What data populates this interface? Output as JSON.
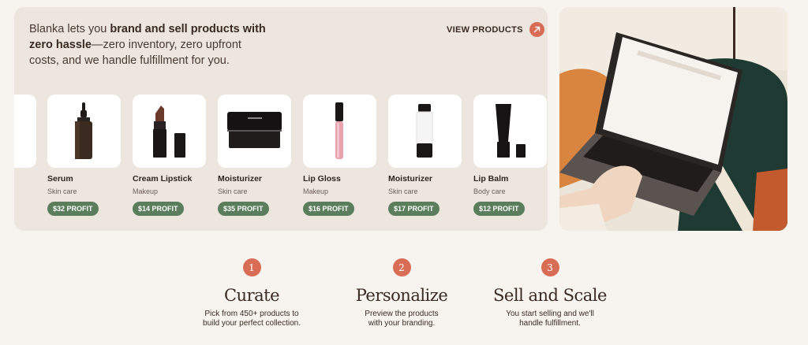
{
  "intro": {
    "prefix": "Blanka lets you ",
    "bold": "brand and sell products with zero hassle",
    "suffix": "—zero inventory, zero upfront costs, and we handle fulfillment for you."
  },
  "view_products": {
    "label": "VIEW PRODUCTS",
    "icon": "arrow-up-right-icon"
  },
  "products": [
    {
      "name": "Serum",
      "category": "Skin care",
      "profit": "$32 PROFIT"
    },
    {
      "name": "Cream Lipstick",
      "category": "Makeup",
      "profit": "$14 PROFIT"
    },
    {
      "name": "Moisturizer",
      "category": "Skin care",
      "profit": "$35 PROFIT"
    },
    {
      "name": "Lip Gloss",
      "category": "Makeup",
      "profit": "$16 PROFIT"
    },
    {
      "name": "Moisturizer",
      "category": "Skin care",
      "profit": "$17 PROFIT"
    },
    {
      "name": "Lip Balm",
      "category": "Body care",
      "profit": "$12 PROFIT"
    }
  ],
  "steps": [
    {
      "number": "1",
      "title": "Curate",
      "desc_line1": "Pick from 450+ products to",
      "desc_line2": "build your perfect collection."
    },
    {
      "number": "2",
      "title": "Personalize",
      "desc_line1": "Preview the products",
      "desc_line2": "with your branding."
    },
    {
      "number": "3",
      "title": "Sell and Scale",
      "desc_line1": "You start selling and we'll",
      "desc_line2": "handle fulfillment."
    }
  ],
  "colors": {
    "accent": "#d96c55",
    "profit_badge": "#5a7d5c",
    "panel_bg": "#ece6de",
    "page_bg": "#f7f3ee"
  }
}
